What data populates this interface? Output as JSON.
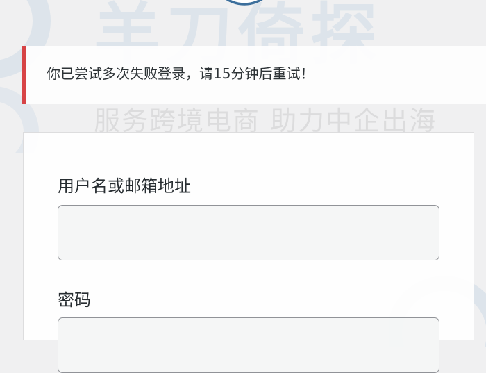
{
  "watermark": {
    "logo_text": "羊刀倚探",
    "slogan": "服务跨境电商 助力中企出海"
  },
  "login_error": {
    "message": "你已尝试多次失败登录，请15分钟后重试！",
    "accent_color": "#d63638"
  },
  "login_form": {
    "username_label": "用户名或邮箱地址",
    "username_value": "",
    "password_label": "密码",
    "password_value": ""
  },
  "icons": {
    "site_logo": "site-logo-icon",
    "watermark_logo": "watermark-logo-icon"
  }
}
